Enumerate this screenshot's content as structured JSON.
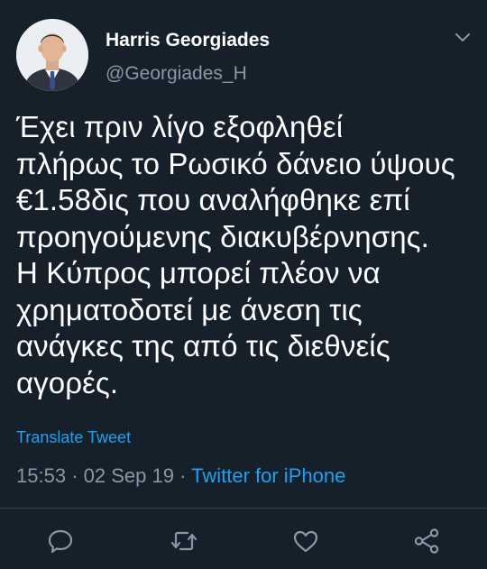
{
  "author": {
    "display_name": "Harris Georgiades",
    "handle": "@Georgiades_H"
  },
  "tweet": {
    "text": "Έχει πριν λίγο εξοφληθεί\nπλήρως το Ρωσικό δάνειο ύψους\n€1.58δις που αναλήφθηκε επί\nπροηγούμενης διακυβέρνησης.\nΗ Κύπρος μπορεί πλέον να\nχρηματοδοτεί με άνεση τις\nανάγκες της από τις διεθνείς\nαγορές.",
    "translate_label": "Translate Tweet",
    "time": "15:53",
    "date": "02 Sep 19",
    "separator": "·",
    "source": "Twitter for iPhone"
  },
  "icons": {
    "menu": "chevron-down-icon",
    "reply": "reply-icon",
    "retweet": "retweet-icon",
    "like": "heart-icon",
    "share": "share-icon"
  },
  "colors": {
    "background": "#15202b",
    "accent": "#1da1f2",
    "muted": "#8899a6",
    "text": "#ffffff"
  }
}
